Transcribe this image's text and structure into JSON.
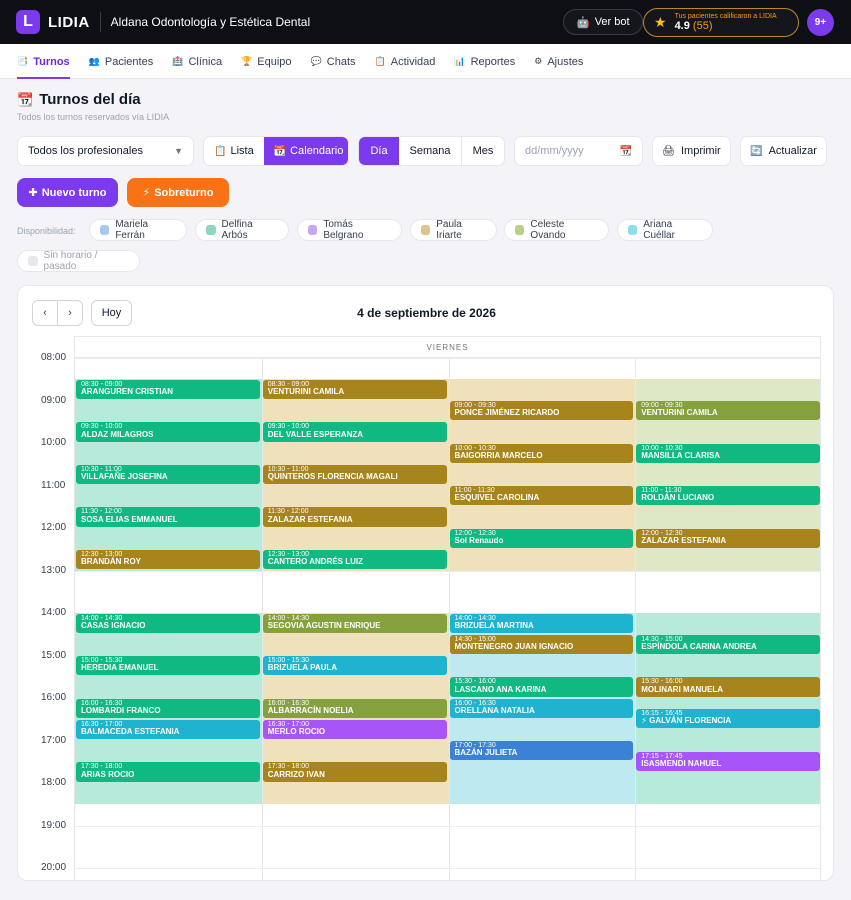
{
  "topbar": {
    "logo_letter": "L",
    "brand": "LIDIA",
    "clinic_name": "Aldana Odontología y Estética Dental",
    "ver_bot_label": "Ver bot",
    "rating_label": "Tus pacientes calificaron a LIDIA",
    "rating_value": "4.9",
    "rating_count": "(55)",
    "notifications": "9+"
  },
  "nav": {
    "items": [
      {
        "icon": "calendar-icon",
        "glyph": "📑",
        "label": "Turnos",
        "active": true
      },
      {
        "icon": "users-icon",
        "glyph": "👥",
        "label": "Pacientes"
      },
      {
        "icon": "clinic-icon",
        "glyph": "🏥",
        "label": "Clínica"
      },
      {
        "icon": "trophy-icon",
        "glyph": "🏆",
        "label": "Equipo"
      },
      {
        "icon": "chat-icon",
        "glyph": "💬",
        "label": "Chats"
      },
      {
        "icon": "activity-icon",
        "glyph": "📋",
        "label": "Actividad"
      },
      {
        "icon": "chart-icon",
        "glyph": "📊",
        "label": "Reportes"
      },
      {
        "icon": "gear-icon",
        "glyph": "⚙",
        "label": "Ajustes"
      }
    ]
  },
  "page": {
    "title": "Turnos del día",
    "subtitle": "Todos los turnos reservados vía LIDIA"
  },
  "filters": {
    "professional_value": "Todos los profesionales",
    "view_list": "Lista",
    "view_calendar": "Calendario",
    "range_day": "Día",
    "range_week": "Semana",
    "range_month": "Mes",
    "date_placeholder": "dd/mm/yyyy",
    "print_label": "Imprimir",
    "refresh_label": "Actualizar",
    "new_label": "Nuevo turno",
    "over_label": "Sobreturno"
  },
  "availability": {
    "label": "Disponibilidad:",
    "professionals": [
      {
        "name": "Mariela Ferrán",
        "color": "#a9c8ec"
      },
      {
        "name": "Delfina Arbós",
        "color": "#8ad8bf"
      },
      {
        "name": "Tomás Belgrano",
        "color": "#c7a6f2"
      },
      {
        "name": "Paula Iriarte",
        "color": "#dcc58e"
      },
      {
        "name": "Celeste Ovando",
        "color": "#b9d089"
      },
      {
        "name": "Ariana Cuéllar",
        "color": "#8fdde8"
      }
    ],
    "past_label": "Sin horario / pasado",
    "past_color": "#e5e7eb"
  },
  "calendar": {
    "date_title": "4 de septiembre de 2026",
    "today_label": "Hoy",
    "day_header": "VIERNES",
    "hours": [
      "08:00",
      "09:00",
      "10:00",
      "11:00",
      "12:00",
      "13:00",
      "14:00",
      "15:00",
      "16:00",
      "17:00",
      "18:00",
      "19:00",
      "20:00"
    ],
    "avail_blocks": [
      {
        "col": 0,
        "from": "08:30",
        "to": "13:00",
        "color": "#b8eadb"
      },
      {
        "col": 0,
        "from": "14:00",
        "to": "18:30",
        "color": "#b8eadb"
      },
      {
        "col": 1,
        "from": "08:30",
        "to": "13:00",
        "color": "#efe1bc"
      },
      {
        "col": 1,
        "from": "14:00",
        "to": "18:30",
        "color": "#efe1bc"
      },
      {
        "col": 2,
        "from": "08:30",
        "to": "13:00",
        "color": "#efe1bc"
      },
      {
        "col": 2,
        "from": "14:00",
        "to": "18:30",
        "color": "#bfe9f0"
      },
      {
        "col": 3,
        "from": "08:30",
        "to": "13:00",
        "color": "#dfe8c6"
      },
      {
        "col": 3,
        "from": "14:00",
        "to": "18:30",
        "color": "#b8eadb"
      }
    ],
    "events": [
      {
        "col": 0,
        "start": "08:30",
        "end": "09:00",
        "time": "08:30 - 09:00",
        "name": "ARANGUREN CRISTIAN",
        "color": "#10b981"
      },
      {
        "col": 0,
        "start": "09:30",
        "end": "10:00",
        "time": "09:30 - 10:00",
        "name": "ALDAZ MILAGROS",
        "color": "#10b981"
      },
      {
        "col": 0,
        "start": "10:30",
        "end": "11:00",
        "time": "10:30 - 11:00",
        "name": "VILLAFAÑE JOSEFINA",
        "color": "#10b981"
      },
      {
        "col": 0,
        "start": "11:30",
        "end": "12:00",
        "time": "11:30 - 12:00",
        "name": "SOSA ELIAS EMMANUEL",
        "color": "#10b981"
      },
      {
        "col": 0,
        "start": "12:30",
        "end": "13:00",
        "time": "12:30 - 13:00",
        "name": "BRANDÁN ROY",
        "color": "#a8841c"
      },
      {
        "col": 0,
        "start": "14:00",
        "end": "14:30",
        "time": "14:00 - 14:30",
        "name": "CASAS IGNACIO",
        "color": "#10b981"
      },
      {
        "col": 0,
        "start": "15:00",
        "end": "15:30",
        "time": "15:00 - 15:30",
        "name": "HEREDIA EMANUEL",
        "color": "#10b981"
      },
      {
        "col": 0,
        "start": "16:00",
        "end": "16:30",
        "time": "16:00 - 16:30",
        "name": "LOMBARDI FRANCO",
        "color": "#10b981"
      },
      {
        "col": 0,
        "start": "16:30",
        "end": "17:00",
        "time": "16:30 - 17:00",
        "name": "BALMACEDA ESTEFANIA",
        "color": "#1fb3cf"
      },
      {
        "col": 0,
        "start": "17:30",
        "end": "18:00",
        "time": "17:30 - 18:00",
        "name": "ARIAS ROCIO",
        "color": "#10b981"
      },
      {
        "col": 1,
        "start": "08:30",
        "end": "09:00",
        "time": "08:30 - 09:00",
        "name": "VENTURINI CAMILA",
        "color": "#a8841c"
      },
      {
        "col": 1,
        "start": "09:30",
        "end": "10:00",
        "time": "09:30 - 10:00",
        "name": "DEL VALLE ESPERANZA",
        "color": "#10b981"
      },
      {
        "col": 1,
        "start": "10:30",
        "end": "11:00",
        "time": "10:30 - 11:00",
        "name": "QUINTEROS FLORENCIA MAGALI",
        "color": "#a8841c"
      },
      {
        "col": 1,
        "start": "11:30",
        "end": "12:00",
        "time": "11:30 - 12:00",
        "name": "ZALAZAR ESTEFANIA",
        "color": "#a8841c"
      },
      {
        "col": 1,
        "start": "12:30",
        "end": "13:00",
        "time": "12:30 - 13:00",
        "name": "CANTERO ANDRÉS LUIZ",
        "color": "#10b981"
      },
      {
        "col": 1,
        "start": "14:00",
        "end": "14:30",
        "time": "14:00 - 14:30",
        "name": "SEGOVIA AGUSTIN ENRIQUE",
        "color": "#84a13e"
      },
      {
        "col": 1,
        "start": "15:00",
        "end": "15:30",
        "time": "15:00 - 15:30",
        "name": "BRIZUELA PAULA",
        "color": "#1fb3cf"
      },
      {
        "col": 1,
        "start": "16:00",
        "end": "16:30",
        "time": "16:00 - 16:30",
        "name": "ALBARRACÍN NOELIA",
        "color": "#84a13e"
      },
      {
        "col": 1,
        "start": "16:30",
        "end": "17:00",
        "time": "16:30 - 17:00",
        "name": "MERLO ROCIO",
        "color": "#a855f7"
      },
      {
        "col": 1,
        "start": "17:30",
        "end": "18:00",
        "time": "17:30 - 18:00",
        "name": "CARRIZO IVAN",
        "color": "#a8841c"
      },
      {
        "col": 2,
        "start": "09:00",
        "end": "09:30",
        "time": "09:00 - 09:30",
        "name": "PONCE JIMÉNEZ RICARDO",
        "color": "#a8841c"
      },
      {
        "col": 2,
        "start": "10:00",
        "end": "10:30",
        "time": "10:00 - 10:30",
        "name": "BAIGORRIA MARCELO",
        "color": "#a8841c"
      },
      {
        "col": 2,
        "start": "11:00",
        "end": "11:30",
        "time": "11:00 - 11:30",
        "name": "ESQUIVEL CAROLINA",
        "color": "#a8841c"
      },
      {
        "col": 2,
        "start": "12:00",
        "end": "12:30",
        "time": "12:00 - 12:30",
        "name": "Sol Renaudo",
        "color": "#10b981"
      },
      {
        "col": 2,
        "start": "14:00",
        "end": "14:30",
        "time": "14:00 - 14:30",
        "name": "BRIZUELA MARTINA",
        "color": "#1fb3cf"
      },
      {
        "col": 2,
        "start": "14:30",
        "end": "15:00",
        "time": "14:30 - 15:00",
        "name": "MONTENEGRO JUAN IGNACIO",
        "color": "#a8841c"
      },
      {
        "col": 2,
        "start": "15:30",
        "end": "16:00",
        "time": "15:30 - 16:00",
        "name": "LASCANO ANA KARINA",
        "color": "#10b981"
      },
      {
        "col": 2,
        "start": "16:00",
        "end": "16:30",
        "time": "16:00 - 16:30",
        "name": "ORELLANA NATALIA",
        "color": "#1fb3cf"
      },
      {
        "col": 2,
        "start": "17:00",
        "end": "17:30",
        "time": "17:00 - 17:30",
        "name": "BAZÁN JULIETA",
        "color": "#3b82d6"
      },
      {
        "col": 3,
        "start": "09:00",
        "end": "09:30",
        "time": "09:00 - 09:30",
        "name": "VENTURINI CAMILA",
        "color": "#84a13e"
      },
      {
        "col": 3,
        "start": "10:00",
        "end": "10:30",
        "time": "10:00 - 10:30",
        "name": "MANSILLA CLARISA",
        "color": "#10b981"
      },
      {
        "col": 3,
        "start": "11:00",
        "end": "11:30",
        "time": "11:00 - 11:30",
        "name": "ROLDÁN LUCIANO",
        "color": "#10b981"
      },
      {
        "col": 3,
        "start": "12:00",
        "end": "12:30",
        "time": "12:00 - 12:30",
        "name": "ZALAZAR ESTEFANIA",
        "color": "#a8841c"
      },
      {
        "col": 3,
        "start": "14:30",
        "end": "15:00",
        "time": "14:30 - 15:00",
        "name": "ESPÍNDOLA CARINA ANDREA",
        "color": "#10b981"
      },
      {
        "col": 3,
        "start": "15:30",
        "end": "16:00",
        "time": "15:30 - 16:00",
        "name": "MOLINARI MANUELA",
        "color": "#a8841c"
      },
      {
        "col": 3,
        "start": "16:15",
        "end": "16:45",
        "time": "16:15 - 16:45",
        "name": "⚡ GALVÁN FLORENCIA",
        "color": "#1fb3cf"
      },
      {
        "col": 3,
        "start": "17:15",
        "end": "17:45",
        "time": "17:15 - 17:45",
        "name": "ISASMENDI NAHUEL",
        "color": "#a855f7"
      }
    ]
  }
}
